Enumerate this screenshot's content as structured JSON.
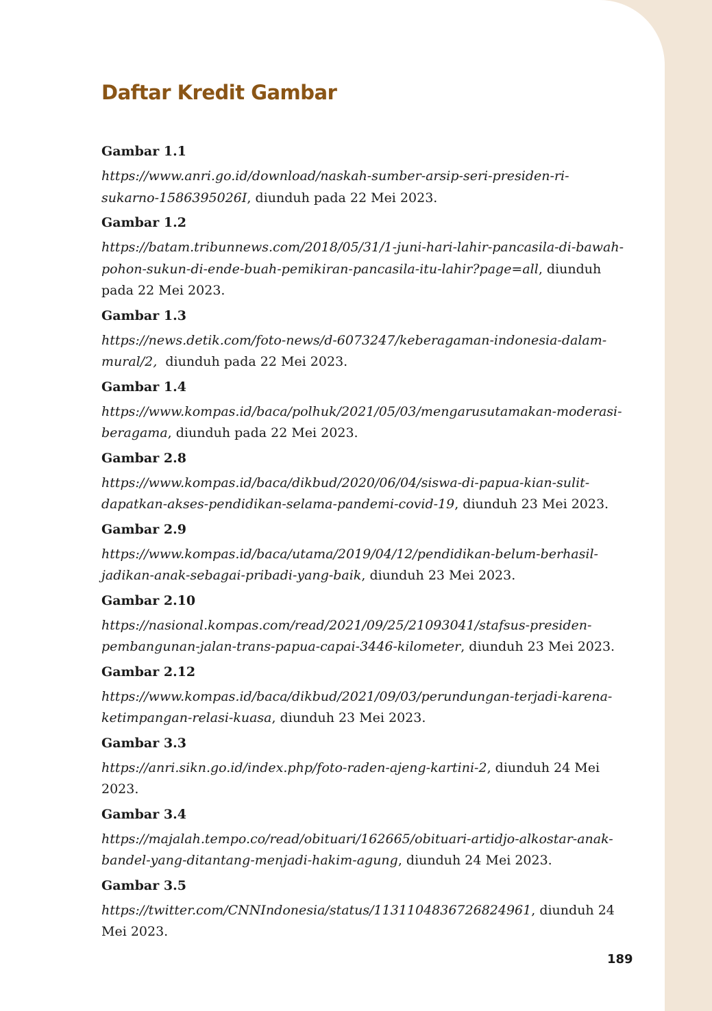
{
  "title": "Daftar Kredit Gambar",
  "page_number": "189",
  "entries": [
    {
      "heading": "Gambar 1.1",
      "line1_url": "https://www.anri.go.id/download/naskah-sumber-arsip-seri-presiden-ri-",
      "line2_url": "sukarno-1586395026I",
      "line2_text": ", diunduh pada 22 Mei 2023.",
      "line3_text": ""
    },
    {
      "heading": "Gambar 1.2",
      "line1_url": "https://batam.tribunnews.com/2018/05/31/1-juni-hari-lahir-pancasila-di-bawah-",
      "line2_url": "pohon-sukun-di-ende-buah-pemikiran-pancasila-itu-lahir?page=all",
      "line2_text": ", diunduh",
      "line3_text": "pada 22 Mei 2023."
    },
    {
      "heading": "Gambar 1.3",
      "line1_url": "https://news.detik.com/foto-news/d-6073247/keberagaman-indonesia-dalam-",
      "line2_url": "mural/2,",
      "line2_text": "  diunduh pada 22 Mei 2023.",
      "line3_text": ""
    },
    {
      "heading": "Gambar 1.4",
      "line1_url": "https://www.kompas.id/baca/polhuk/2021/05/03/mengarusutamakan-moderasi-",
      "line2_url": "beragama",
      "line2_text": ", diunduh pada 22 Mei 2023.",
      "line3_text": ""
    },
    {
      "heading": "Gambar 2.8",
      "line1_url": "https://www.kompas.id/baca/dikbud/2020/06/04/siswa-di-papua-kian-sulit-",
      "line2_url": "dapatkan-akses-pendidikan-selama-pandemi-covid-19",
      "line2_text": ", diunduh 23 Mei 2023.",
      "line3_text": ""
    },
    {
      "heading": "Gambar 2.9",
      "line1_url": "https://www.kompas.id/baca/utama/2019/04/12/pendidikan-belum-berhasil-",
      "line2_url": "jadikan-anak-sebagai-pribadi-yang-baik",
      "line2_text": ", diunduh 23 Mei 2023.",
      "line3_text": ""
    },
    {
      "heading": "Gambar 2.10",
      "line1_url": "https://nasional.kompas.com/read/2021/09/25/21093041/stafsus-presiden-",
      "line2_url": "pembangunan-jalan-trans-papua-capai-3446-kilometer",
      "line2_text": ", diunduh 23 Mei 2023.",
      "line3_text": ""
    },
    {
      "heading": "Gambar 2.12",
      "line1_url": "https://www.kompas.id/baca/dikbud/2021/09/03/perundungan-terjadi-karena-",
      "line2_url": "ketimpangan-relasi-kuasa",
      "line2_text": ", diunduh 23 Mei 2023.",
      "line3_text": ""
    },
    {
      "heading": "Gambar 3.3",
      "line1_url": "https://anri.sikn.go.id/index.php/foto-raden-ajeng-kartini-2",
      "line1_text": ", diunduh 24 Mei 2023.",
      "line2_url": "",
      "line2_text": "",
      "line3_text": ""
    },
    {
      "heading": "Gambar 3.4",
      "line1_url": "https://majalah.tempo.co/read/obituari/162665/obituari-artidjo-alkostar-anak-",
      "line2_url": "bandel-yang-ditantang-menjadi-hakim-agung",
      "line2_text": ", diunduh 24 Mei 2023.",
      "line3_text": ""
    },
    {
      "heading": "Gambar 3.5",
      "line1_url": "https://twitter.com/CNNIndonesia/status/1131104836726824961",
      "line1_text": ", diunduh 24",
      "line2_url": "",
      "line2_text": "Mei 2023.",
      "line3_text": ""
    }
  ]
}
